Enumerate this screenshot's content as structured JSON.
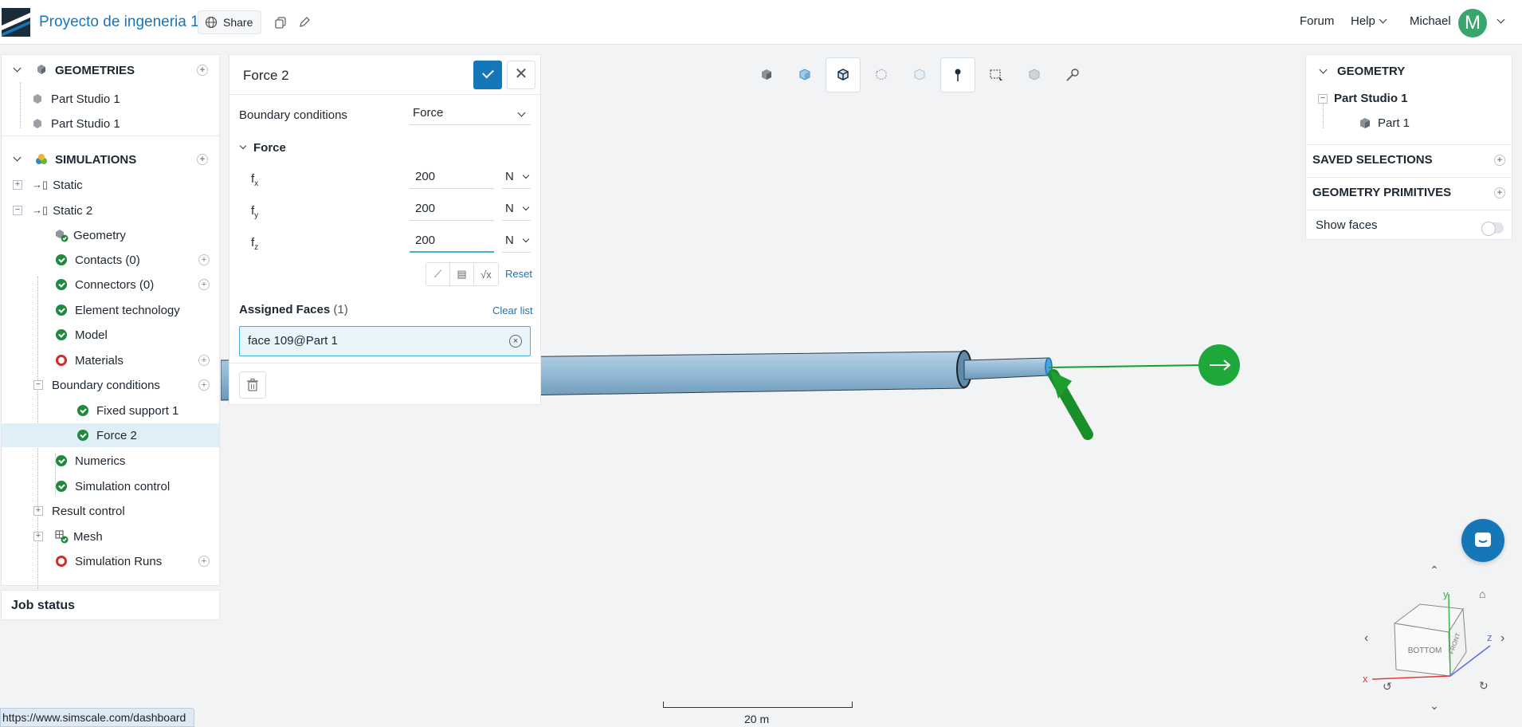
{
  "app": {
    "project_title": "Proyecto de ingeneria 1",
    "share_label": "Share",
    "nav": {
      "forum": "Forum",
      "help": "Help",
      "user": "Michael",
      "avatar_initial": "M"
    }
  },
  "tree": {
    "geometries_header": "GEOMETRIES",
    "geometries": [
      "Part Studio 1",
      "Part Studio 1"
    ],
    "simulations_header": "SIMULATIONS",
    "simulations": [
      "Static",
      "Static 2"
    ],
    "items": {
      "geometry": "Geometry",
      "contacts": "Contacts (0)",
      "connectors": "Connectors (0)",
      "element_technology": "Element technology",
      "model": "Model",
      "materials": "Materials",
      "boundary_conditions": "Boundary conditions",
      "fixed_support": "Fixed support 1",
      "force": "Force 2",
      "numerics": "Numerics",
      "simulation_control": "Simulation control",
      "result_control": "Result control",
      "mesh": "Mesh",
      "simulation_runs": "Simulation Runs"
    },
    "job_status": "Job status"
  },
  "force_panel": {
    "title": "Force 2",
    "bc_label": "Boundary conditions",
    "bc_value": "Force",
    "section": "Force",
    "components": [
      {
        "sym": "f",
        "sub": "x",
        "value": "200",
        "unit": "N"
      },
      {
        "sym": "f",
        "sub": "y",
        "value": "200",
        "unit": "N"
      },
      {
        "sym": "f",
        "sub": "z",
        "value": "200",
        "unit": "N"
      }
    ],
    "reset": "Reset",
    "assigned_label": "Assigned Faces",
    "assigned_count": "(1)",
    "clear_list": "Clear list",
    "face": "face 109@Part 1"
  },
  "right_panel": {
    "geometry_header": "GEOMETRY",
    "part_studio": "Part Studio 1",
    "part": "Part 1",
    "saved_selections": "SAVED SELECTIONS",
    "geometry_primitives": "GEOMETRY PRIMITIVES",
    "show_faces": "Show faces",
    "show_faces_on": false
  },
  "viewport": {
    "scale_label": "20 m",
    "cube_bottom": "BOTTOM",
    "cube_front": "FRONT",
    "axis_x": "x",
    "axis_y": "y",
    "axis_z": "z"
  },
  "status_url": "https://www.simscale.com/dashboard",
  "colors": {
    "accent": "#1576b8",
    "success": "#1e8a3d",
    "error": "#d62b2b",
    "force_arrow": "#1e9e2e",
    "pipe": "#8fb7d4"
  }
}
